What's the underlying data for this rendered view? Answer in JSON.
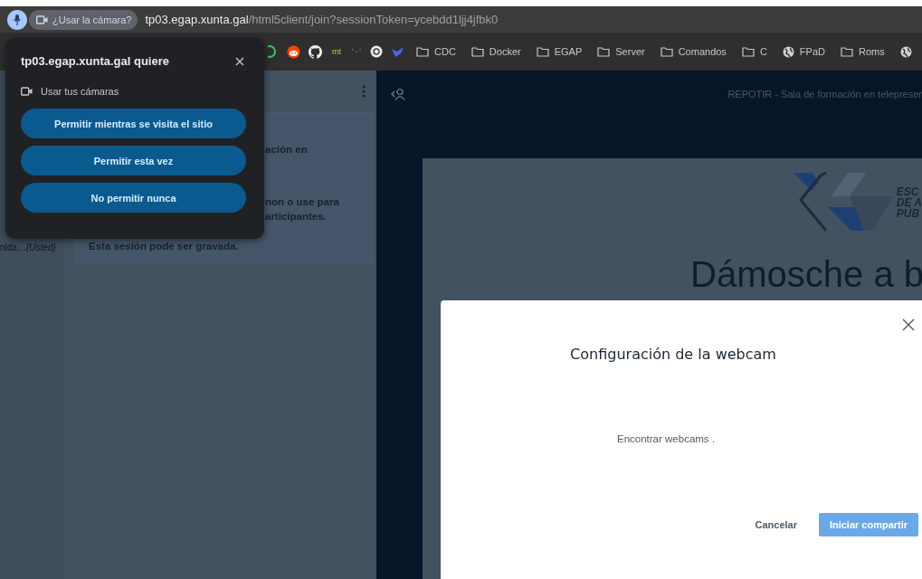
{
  "address_bar": {
    "permission_chip": "¿Usar la cámara?",
    "url_host": "tp03.egap.xunta.gal",
    "url_path": "/html5client/join?sessionToken=ycebdd1ljj4jfbk0"
  },
  "bookmarks": {
    "badge_text": "mt",
    "items": [
      {
        "kind": "folder",
        "label": "CDC"
      },
      {
        "kind": "folder",
        "label": "Docker"
      },
      {
        "kind": "folder",
        "label": "EGAP"
      },
      {
        "kind": "folder",
        "label": "Server"
      },
      {
        "kind": "folder",
        "label": "Comandos"
      },
      {
        "kind": "folder",
        "label": "C"
      },
      {
        "kind": "site",
        "label": "FPaD"
      },
      {
        "kind": "folder",
        "label": "Roms"
      },
      {
        "kind": "site"
      }
    ]
  },
  "permission_popup": {
    "title": "tp03.egap.xunta.gal quiere",
    "request": "Usar tus cámaras",
    "buttons": [
      "Permitir mientras se visita el sitio",
      "Permitir esta vez",
      "No permitir nunca"
    ]
  },
  "user_list": {
    "user_name": "nlda…",
    "user_suffix": "(Usted)"
  },
  "chat": {
    "message_lines": [
      "ación en",
      "non o use para",
      "articipantes."
    ],
    "notice": "Esta sesión pode ser gravada."
  },
  "main": {
    "title": "REPOTIR - Sala de formación en telepreser",
    "slide": {
      "logo_lines": [
        "ESC",
        "DE A",
        "PÚB"
      ],
      "heading": "Dámosche a b"
    }
  },
  "webcam_modal": {
    "title": "Configuración de la webcam",
    "status": "Encontrar webcams .",
    "cancel": "Cancelar",
    "confirm": "Iniciar compartir"
  }
}
